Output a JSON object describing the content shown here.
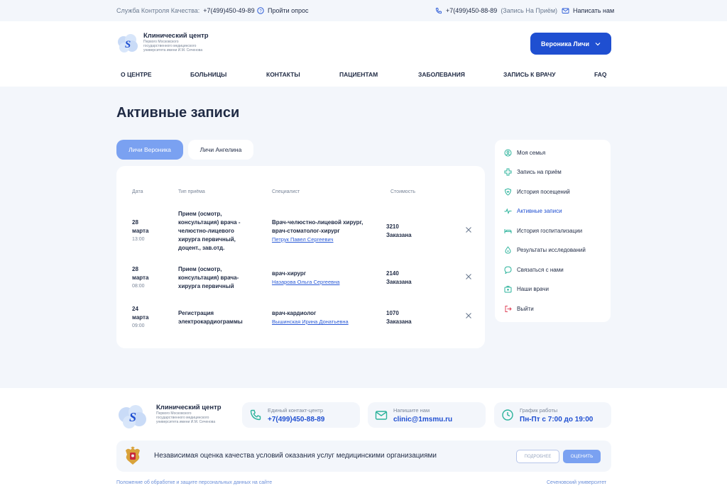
{
  "topbar": {
    "quality_label": "Служба Контроля Качества:",
    "quality_phone": "+7(499)450-49-89",
    "survey": "Пройти опрос",
    "phone": "+7(499)450-88-89",
    "phone_note": "(Запись На Приём)",
    "write_us": "Написать нам"
  },
  "header": {
    "logo_title": "Клинический центр",
    "logo_sub": "Первого Московского государственного медицинского университета имени И.М. Сеченова",
    "user_button": "Вероника Личи"
  },
  "nav": [
    "О ЦЕНТРЕ",
    "БОЛЬНИЦЫ",
    "КОНТАКТЫ",
    "ПАЦИЕНТАМ",
    "ЗАБОЛЕВАНИЯ",
    "ЗАПИСЬ К ВРАЧУ",
    "FAQ"
  ],
  "page_title": "Активные записи",
  "tabs": [
    "Личи Вероника",
    "Личи Ангелина"
  ],
  "table": {
    "headers": [
      "Дата",
      "Тип приёма",
      "Специалист",
      "Стоимость"
    ],
    "rows": [
      {
        "day": "28",
        "month": "марта",
        "time": "13:00",
        "type": "Прием (осмотр, консультация) врача - челюстно-лицевого хирурга первичный, доцент., зав.отд.",
        "specialty": "Врач-челюстно-лицевой хирург, врач-стоматолог-хирург",
        "doctor": "Петрук Павел Сергеевич",
        "price": "3210",
        "status": "Заказана"
      },
      {
        "day": "28",
        "month": "марта",
        "time": "08:00",
        "type": "Прием (осмотр, консультация) врача-хирурга первичный",
        "specialty": "врач-хирург",
        "doctor": "Назарова Ольга Сергеевна",
        "price": "2140",
        "status": "Заказана"
      },
      {
        "day": "24",
        "month": "марта",
        "time": "09:00",
        "type": "Регистрация электрокардиограммы",
        "specialty": "врач-кардиолог",
        "doctor": "Вышинская Ирина Донатьевна",
        "price": "1070",
        "status": "Заказана"
      }
    ]
  },
  "sidebar": [
    {
      "label": "Моя семья",
      "icon": "family-icon"
    },
    {
      "label": "Запись на приём",
      "icon": "plus-cross-icon"
    },
    {
      "label": "История посещений",
      "icon": "heart-shield-icon"
    },
    {
      "label": "Активные записи",
      "icon": "pulse-icon",
      "active": true
    },
    {
      "label": "История госпитализации",
      "icon": "bed-icon"
    },
    {
      "label": "Результаты исследований",
      "icon": "drop-icon"
    },
    {
      "label": "Связаться с нами",
      "icon": "chat-icon"
    },
    {
      "label": "Наши врачи",
      "icon": "medkit-icon"
    },
    {
      "label": "Выйти",
      "icon": "logout-icon"
    }
  ],
  "footer": {
    "logo_title": "Клинический центр",
    "logo_sub": "Первого Московского государственного медицинского университета имени И.М. Сеченова",
    "contact_label": "Единый контакт-центр",
    "contact_value": "+7(499)450-88-89",
    "mail_label": "Напишите нам",
    "mail_value": "clinic@1msmu.ru",
    "hours_label": "График работы",
    "hours_value": "Пн-Пт с 7:00 до 19:00",
    "banner_text": "Независимая оценка качества условий оказания услуг медицинскими организациями",
    "more_button": "ПОДРОБНЕЕ",
    "rate_button": "ОЦЕНИТЬ",
    "privacy_link": "Положение об обработке и защите персональных данных на сайте",
    "university_link": "Сеченовский университет"
  },
  "colors": {
    "accent": "#1f4fd1",
    "accent_light": "#7aa1f1",
    "background": "#f3f6fb",
    "icon_green": "#2bb39b",
    "logout_red": "#e0445a"
  }
}
